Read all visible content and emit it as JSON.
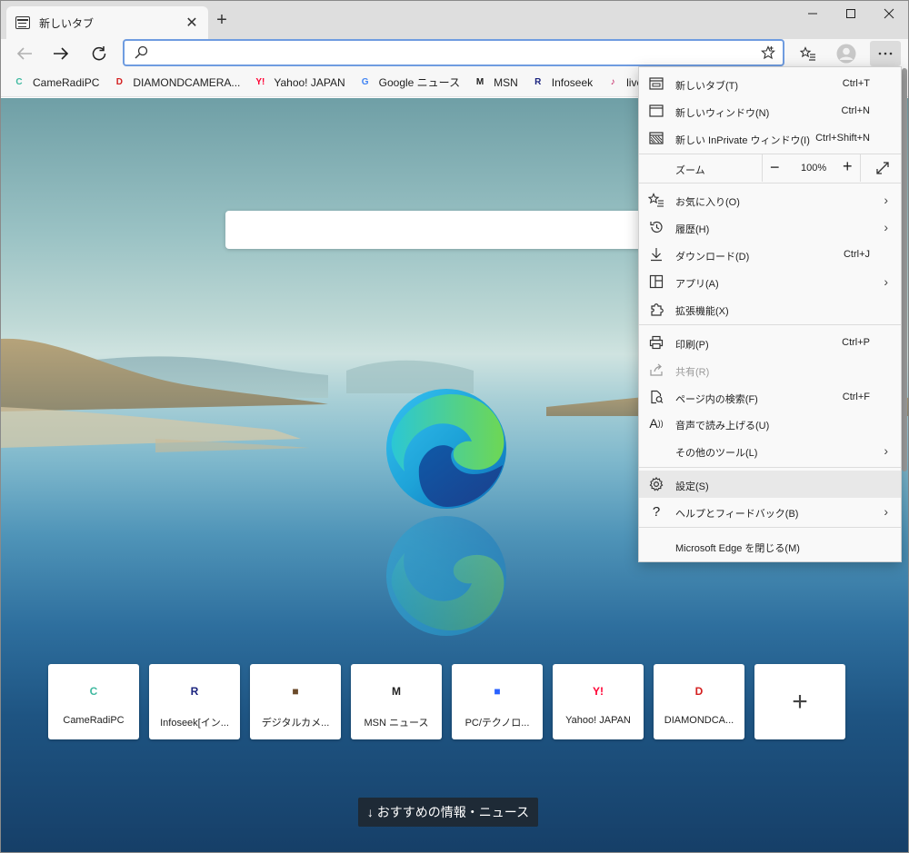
{
  "tab": {
    "title": "新しいタブ"
  },
  "address": {
    "value": "",
    "placeholder": ""
  },
  "favorites": [
    {
      "label": "CameRadiPC",
      "icon": "cameradipc-icon",
      "color": "#3fb9a0",
      "glyph": "C"
    },
    {
      "label": "DIAMONDCAMERA...",
      "icon": "diamondcamera-icon",
      "color": "#d42020",
      "glyph": "D"
    },
    {
      "label": "Yahoo! JAPAN",
      "icon": "yahoo-icon",
      "color": "#ff0033",
      "glyph": "Y!"
    },
    {
      "label": "Google ニュース",
      "icon": "google-news-icon",
      "color": "#4285f4",
      "glyph": "G"
    },
    {
      "label": "MSN",
      "icon": "msn-icon",
      "color": "#222222",
      "glyph": "M"
    },
    {
      "label": "Infoseek",
      "icon": "infoseek-icon",
      "color": "#1a237e",
      "glyph": "R"
    },
    {
      "label": "livedoor",
      "icon": "livedoor-icon",
      "color": "#c2185b",
      "glyph": "♪"
    },
    {
      "label": "",
      "icon": "folder-icon",
      "color": "#555555",
      "glyph": ""
    }
  ],
  "menu": {
    "new_tab": {
      "label": "新しいタブ(T)",
      "shortcut": "Ctrl+T"
    },
    "new_window": {
      "label": "新しいウィンドウ(N)",
      "shortcut": "Ctrl+N"
    },
    "new_private": {
      "label": "新しい InPrivate ウィンドウ(I)",
      "shortcut": "Ctrl+Shift+N"
    },
    "zoom": {
      "label": "ズーム",
      "value": "100%",
      "minus": "−",
      "plus": "+"
    },
    "favorites": {
      "label": "お気に入り(O)"
    },
    "history": {
      "label": "履歴(H)"
    },
    "downloads": {
      "label": "ダウンロード(D)",
      "shortcut": "Ctrl+J"
    },
    "apps": {
      "label": "アプリ(A)"
    },
    "extensions": {
      "label": "拡張機能(X)"
    },
    "print": {
      "label": "印刷(P)",
      "shortcut": "Ctrl+P"
    },
    "share": {
      "label": "共有(R)"
    },
    "find": {
      "label": "ページ内の検索(F)",
      "shortcut": "Ctrl+F"
    },
    "read_aloud": {
      "label": "音声で読み上げる(U)"
    },
    "more_tools": {
      "label": "その他のツール(L)"
    },
    "settings": {
      "label": "設定(S)"
    },
    "help": {
      "label": "ヘルプとフィードバック(B)"
    },
    "close": {
      "label": "Microsoft Edge を閉じる(M)"
    }
  },
  "tiles": [
    {
      "label": "CameRadiPC",
      "color": "#3fb9a0",
      "glyph": "C"
    },
    {
      "label": "Infoseek[イン...",
      "color": "#1a237e",
      "glyph": "R"
    },
    {
      "label": "デジタルカメ...",
      "color": "#6b4a2a",
      "glyph": "■"
    },
    {
      "label": "MSN ニュース",
      "color": "#222222",
      "glyph": "M"
    },
    {
      "label": "PC/テクノロ...",
      "color": "#2962ff",
      "glyph": "■"
    },
    {
      "label": "Yahoo! JAPAN",
      "color": "#ff0033",
      "glyph": "Y!"
    },
    {
      "label": "DIAMONDCA...",
      "color": "#d42020",
      "glyph": "D"
    }
  ],
  "add_tile": {
    "label": "+"
  },
  "news_button": {
    "label": "↓  おすすめの情報・ニュース"
  }
}
